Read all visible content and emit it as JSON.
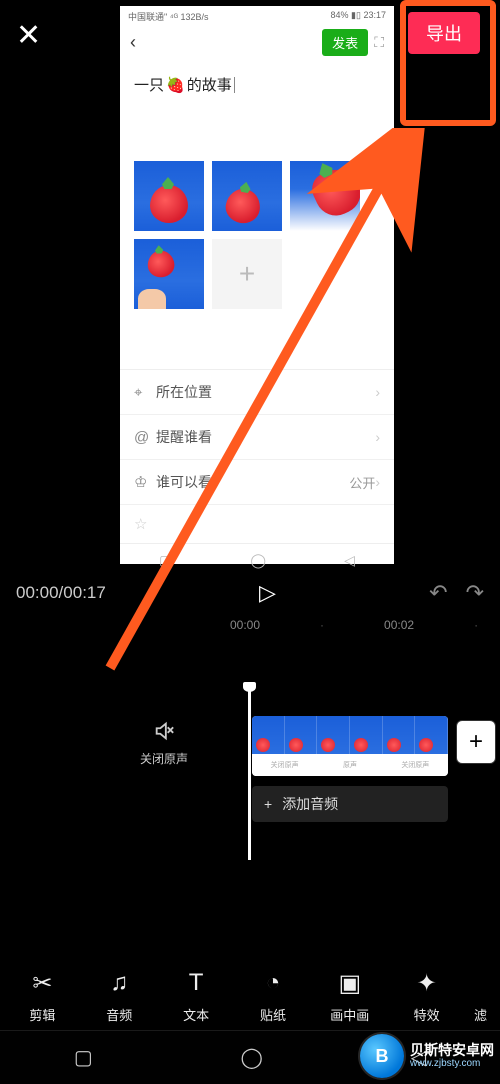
{
  "top": {
    "export_label": "导出"
  },
  "phone": {
    "status_left": "中国联通\" ⁴ᴳ 132B/s",
    "status_right": "84% ▮▯ 23:17",
    "publish_label": "发表",
    "title_pre": "一只",
    "title_emoji": "🍓",
    "title_post": " 的故事",
    "options": [
      {
        "icon": "⌖",
        "label": "所在位置",
        "value": ""
      },
      {
        "icon": "@",
        "label": "提醒谁看",
        "value": ""
      },
      {
        "icon": "♔",
        "label": "谁可以看",
        "value": "公开"
      }
    ]
  },
  "timeline": {
    "current": "00:00",
    "total": "00:17",
    "ticks": [
      "00:00",
      "·",
      "00:02",
      "·"
    ]
  },
  "track": {
    "mute_label": "关闭原声",
    "add_audio_label": "添加音频",
    "clip_meta": [
      "关闭原声",
      "原声",
      "关闭原声"
    ]
  },
  "tools": [
    {
      "name": "cut",
      "icon": "✂",
      "label": "剪辑"
    },
    {
      "name": "audio",
      "icon": "♫",
      "label": "音频"
    },
    {
      "name": "text",
      "icon": "T",
      "label": "文本"
    },
    {
      "name": "sticker",
      "icon": "◔",
      "label": "贴纸"
    },
    {
      "name": "pip",
      "icon": "▣",
      "label": "画中画"
    },
    {
      "name": "fx",
      "icon": "✦",
      "label": "特效"
    },
    {
      "name": "filter",
      "icon": "",
      "label": "滤"
    }
  ],
  "watermark": {
    "title": "贝斯特安卓网",
    "url": "www.zjbsty.com"
  }
}
